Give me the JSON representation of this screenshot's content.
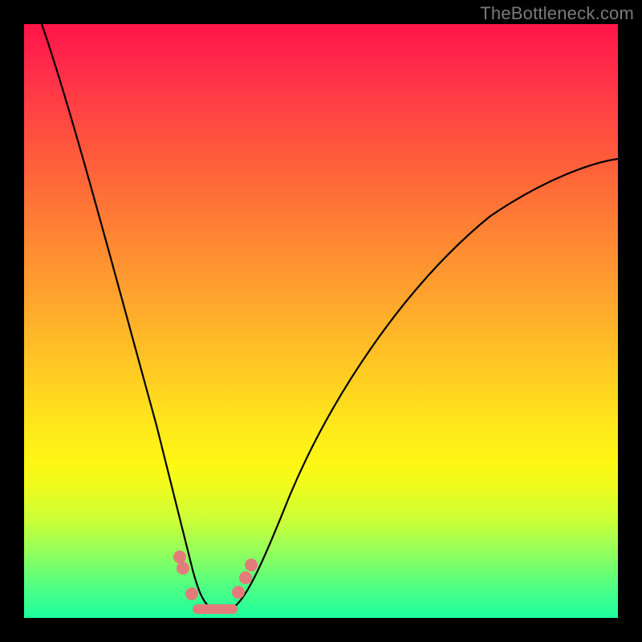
{
  "watermark": "TheBottleneck.com",
  "colors": {
    "frame": "#000000",
    "gradient_top": "#ff1449",
    "gradient_mid1": "#ff8034",
    "gradient_mid2": "#ffe91b",
    "gradient_bottom": "#1cffa0",
    "curve": "#000000",
    "marker": "#e37b7b"
  },
  "chart_data": {
    "type": "line",
    "title": "",
    "xlabel": "",
    "ylabel": "",
    "xlim": [
      0,
      100
    ],
    "ylim": [
      0,
      100
    ],
    "series": [
      {
        "name": "bottleneck-curve",
        "x": [
          0,
          4,
          8,
          12,
          16,
          20,
          23,
          26,
          28,
          30,
          32,
          34,
          36,
          40,
          45,
          52,
          60,
          70,
          80,
          90,
          100
        ],
        "y": [
          100,
          88,
          76,
          64,
          52,
          40,
          28,
          16,
          8,
          3,
          1,
          1,
          3,
          8,
          16,
          28,
          42,
          56,
          66,
          73,
          78
        ]
      }
    ],
    "markers": [
      {
        "x": 25.0,
        "y": 10.0
      },
      {
        "x": 25.8,
        "y": 8.2
      },
      {
        "x": 27.5,
        "y": 4.0
      },
      {
        "x": 35.0,
        "y": 4.5
      },
      {
        "x": 36.2,
        "y": 7.0
      },
      {
        "x": 37.2,
        "y": 9.0
      }
    ],
    "floor_segment": {
      "x0": 28.5,
      "x1": 34.5,
      "y": 1.2
    },
    "notch_x": 31,
    "annotations": []
  }
}
